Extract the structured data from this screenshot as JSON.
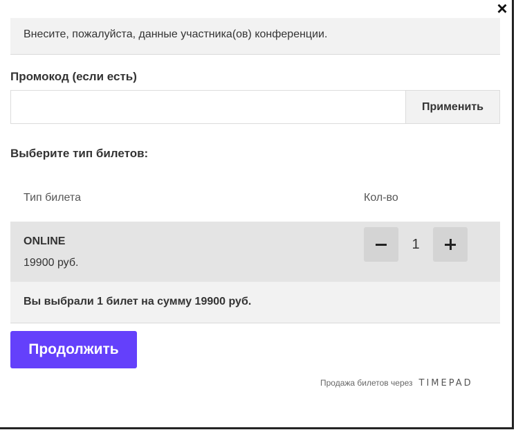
{
  "close_icon": "×",
  "info_text": "Внесите, пожалуйста, данные участника(ов) конференции.",
  "promo": {
    "label": "Промокод (если есть)",
    "value": "",
    "placeholder": "",
    "apply_label": "Применить"
  },
  "tickets_section": {
    "title": "Выберите тип билетов:",
    "col_type": "Тип билета",
    "col_qty": "Кол-во"
  },
  "tickets": [
    {
      "name": "ONLINE",
      "price": "19900 руб.",
      "quantity": "1"
    }
  ],
  "summary": "Вы выбрали 1 билет на сумму 19900 руб.",
  "continue_label": "Продолжить",
  "footer": {
    "text": "Продажа билетов через",
    "brand": "TIMEPAD"
  },
  "colors": {
    "accent": "#6440fb",
    "panel": "#f2f2f2",
    "row": "#e4e4e4",
    "qty_button": "#d4d4d4"
  }
}
